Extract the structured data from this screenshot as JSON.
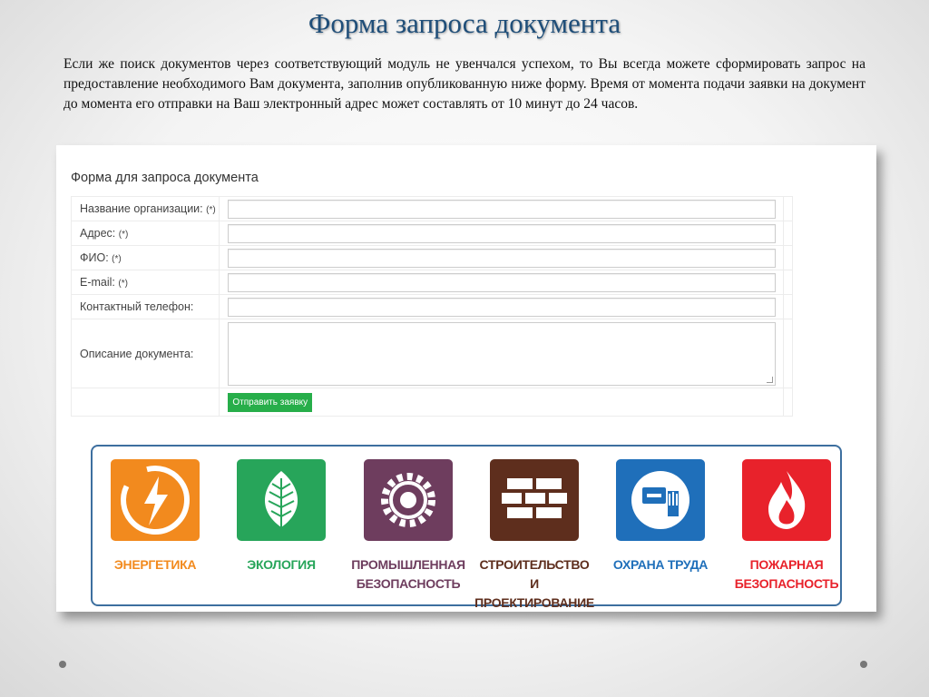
{
  "slide": {
    "title": "Форма запроса документа",
    "intro": "Если же поиск документов через соответствующий модуль не увенчался успехом, то Вы всегда можете сформировать запрос на предоставление необходимого Вам документа, заполнив опубликованную ниже форму. Время от момента подачи заявки на документ до момента его отправки на Ваш электронный адрес может составлять от 10 минут до 24 часов."
  },
  "form": {
    "heading": "Форма для запроса документа",
    "required_mark": "(*)",
    "fields": [
      {
        "label": "Название организации:",
        "required": true,
        "value": ""
      },
      {
        "label": "Адрес:",
        "required": true,
        "value": ""
      },
      {
        "label": "ФИО:",
        "required": true,
        "value": ""
      },
      {
        "label": "E-mail:",
        "required": true,
        "value": ""
      },
      {
        "label": "Контактный телефон:",
        "required": false,
        "value": ""
      },
      {
        "label": "Описание документа:",
        "required": false,
        "value": ""
      }
    ],
    "submit_label": "Отправить заявку"
  },
  "categories": [
    {
      "line1": "ЭНЕРГЕТИКА",
      "line2": "",
      "color": "#f28a1e",
      "label_color": "#f28a1e",
      "icon": "lightning-bolt-icon"
    },
    {
      "line1": "ЭКОЛОГИЯ",
      "line2": "",
      "color": "#27a55a",
      "label_color": "#27a55a",
      "icon": "leaf-icon"
    },
    {
      "line1": "ПРОМЫШЛЕННАЯ",
      "line2": "БЕЗОПАСНОСТЬ",
      "color": "#6e3d5e",
      "label_color": "#6e3d5e",
      "icon": "gear-icon"
    },
    {
      "line1": "СТРОИТЕЛЬСТВО",
      "line2": "И ПРОЕКТИРОВАНИЕ",
      "color": "#5e2e1d",
      "label_color": "#5e2e1d",
      "icon": "brick-wall-icon"
    },
    {
      "line1": "ОХРАНА ТРУДА",
      "line2": "",
      "color": "#1f6fba",
      "label_color": "#1f6fba",
      "icon": "worker-hand-icon"
    },
    {
      "line1": "ПОЖАРНАЯ",
      "line2": "БЕЗОПАСНОСТЬ",
      "color": "#e8222b",
      "label_color": "#e8222b",
      "icon": "flame-icon"
    }
  ]
}
